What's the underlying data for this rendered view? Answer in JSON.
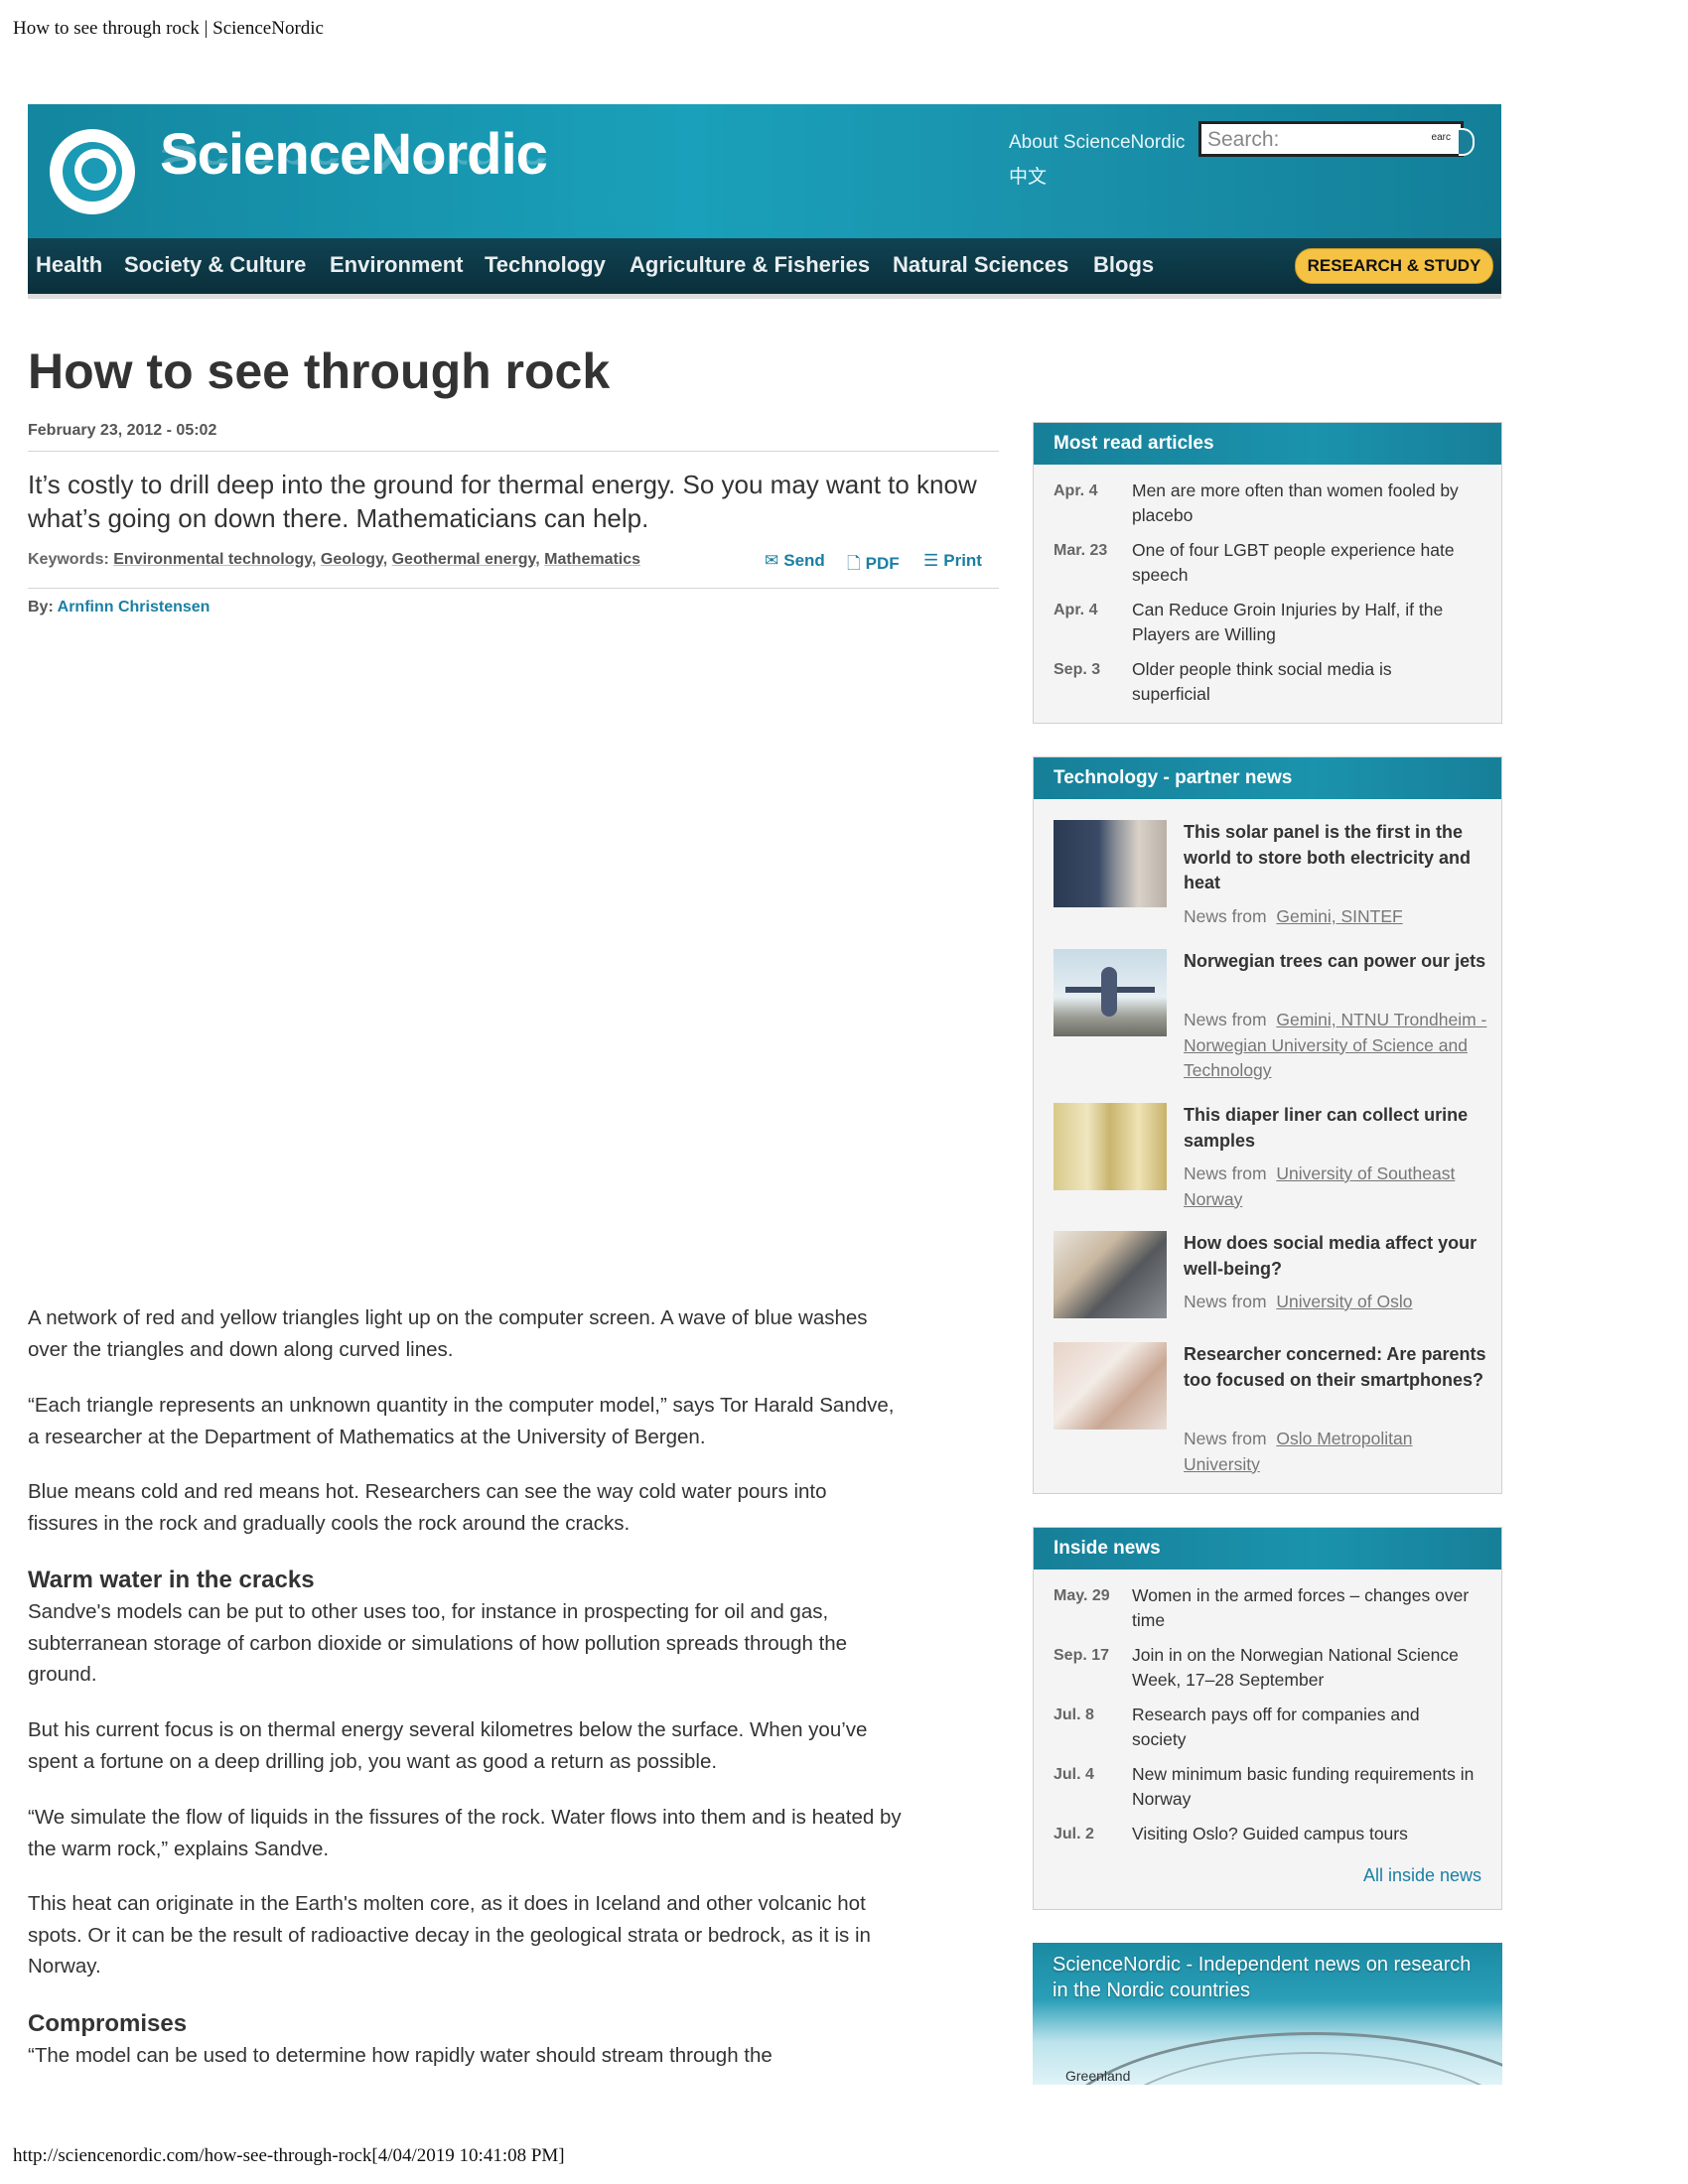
{
  "print": {
    "header": "How to see through rock | ScienceNordic",
    "footer": "http://sciencenordic.com/how-see-through-rock[4/04/2019 10:41:08 PM]"
  },
  "header": {
    "logo_text": "ScienceNordic",
    "about_link": "About ScienceNordic",
    "chinese_link": "中文",
    "search_placeholder": "Search:",
    "search_button": "earc",
    "nav": [
      "Health",
      "Society & Culture",
      "Environment",
      "Technology",
      "Agriculture & Fisheries",
      "Natural Sciences",
      "Blogs"
    ],
    "research_button": "RESEARCH & STUDY",
    "colors": {
      "brand": "#1a8ba3",
      "nav_bg": "#0e3a48",
      "research": "#f5c243",
      "link": "#1a7fa3"
    }
  },
  "article": {
    "title": "How to see through rock",
    "date": "February 23, 2012 - 05:02",
    "lead": "It’s costly to drill deep into the ground for thermal energy. So you may want to know what’s going on down there. Mathematicians can help.",
    "keywords_label": "Keywords:",
    "keywords": [
      "Environmental technology",
      "Geology",
      "Geothermal energy",
      "Mathematics"
    ],
    "tools": {
      "send": "Send",
      "pdf": "PDF",
      "print": "Print"
    },
    "by_label": "By:",
    "author": "Arnfinn Christensen",
    "paragraphs": [
      "A network of red and yellow triangles light up on the computer screen. A wave of blue washes over the triangles and down along curved lines.",
      "“Each triangle represents an unknown quantity in the computer model,” says Tor Harald Sandve, a researcher at the Department of Mathematics at the University of Bergen.",
      "Blue means cold and red means hot. Researchers can see the way cold water pours into fissures in the rock and gradually cools the rock around the cracks."
    ],
    "subhead1": "Warm water in the cracks",
    "paragraphs2": [
      "Sandve's models can be put to other uses too, for instance in prospecting for oil and gas, subterranean storage of carbon dioxide or simulations of how pollution spreads through the ground.",
      "But his current focus is on thermal energy several kilometres below the surface. When you’ve spent a fortune on a deep drilling job, you want as good a return as possible.",
      "“We simulate the flow of liquids in the fissures of the rock. Water flows into them and is heated by the warm rock,” explains Sandve.",
      "This heat can originate in the Earth's molten core, as it does in Iceland and other volcanic hot spots. Or it can be the result of radioactive decay in the geological strata or bedrock, as it is in Norway."
    ],
    "subhead2": "Compromises",
    "paragraph_last": "“The model can be used to determine how rapidly water should stream through the"
  },
  "sidebar": {
    "most_read": {
      "title": "Most read articles",
      "items": [
        {
          "date": "Apr. 4",
          "title": "Men are more often than women fooled by placebo"
        },
        {
          "date": "Mar. 23",
          "title": "One of four LGBT people experience hate speech"
        },
        {
          "date": "Apr. 4",
          "title": "Can Reduce Groin Injuries by Half, if the Players are Willing"
        },
        {
          "date": "Sep. 3",
          "title": "Older people think social media is superficial"
        }
      ]
    },
    "partner": {
      "title": "Technology - partner news",
      "news_from": "News from",
      "items": [
        {
          "title": "This solar panel is the first in the world to store both electricity and heat",
          "source": "Gemini, SINTEF",
          "thumb": "solar-panel-photo"
        },
        {
          "title": "Norwegian trees can power our jets",
          "source": "Gemini, NTNU Trondheim - Norwegian University of Science and Technology",
          "thumb": "airplane-photo"
        },
        {
          "title": "This diaper liner can collect urine samples",
          "source": "University of Southeast Norway",
          "thumb": "diaper-liner-photo"
        },
        {
          "title": "How does social media affect your well-being?",
          "source": "University of Oslo",
          "thumb": "laptop-photo"
        },
        {
          "title": "Researcher concerned: Are parents too focused on their smartphones?",
          "source": "Oslo Metropolitan University",
          "thumb": "parent-baby-photo"
        }
      ]
    },
    "inside": {
      "title": "Inside news",
      "items": [
        {
          "date": "May. 29",
          "title": "Women in the armed forces – changes over time"
        },
        {
          "date": "Sep. 17",
          "title": "Join in on the Norwegian National Science Week, 17–28 September"
        },
        {
          "date": "Jul. 8",
          "title": "Research pays off for companies and society"
        },
        {
          "date": "Jul. 4",
          "title": "New minimum basic funding requirements in Norway"
        },
        {
          "date": "Jul. 2",
          "title": "Visiting Oslo? Guided campus tours"
        }
      ],
      "all_link": "All inside news"
    },
    "promo": {
      "text": "ScienceNordic - Independent news on research in the Nordic countries",
      "map_label": "Greenland"
    }
  }
}
